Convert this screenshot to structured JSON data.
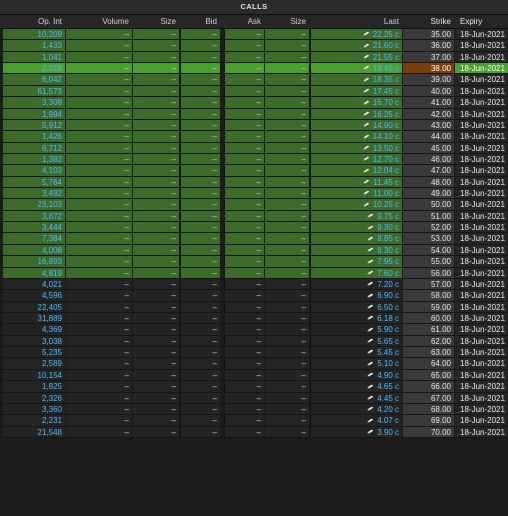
{
  "panel": {
    "title": "CALLS"
  },
  "columns": {
    "op_int": "Op. Int",
    "volume": "Volume",
    "size_bid": "Size",
    "bid": "Bid",
    "ask": "Ask",
    "size_ask": "Size",
    "last": "Last",
    "strike": "Strike",
    "expiry": "Expiry"
  },
  "placeholder": "–",
  "colors": {
    "in_the_money_row": "#3d6b2a",
    "at_the_money_row": "#4aa02c",
    "at_the_money_strike": "#7a3e0c",
    "out_of_money_row": "#242424",
    "value_text": "#4fb8ff"
  },
  "rows": [
    {
      "op_int": "10,209",
      "last": "22.25 c",
      "strike": "35.00",
      "expiry": "18-Jun-2021",
      "state": "itm"
    },
    {
      "op_int": "1,433",
      "last": "21.60 c",
      "strike": "36.00",
      "expiry": "18-Jun-2021",
      "state": "itm"
    },
    {
      "op_int": "1,041",
      "last": "21.55 c",
      "strike": "37.00",
      "expiry": "18-Jun-2021",
      "state": "itm"
    },
    {
      "op_int": "2,028",
      "last": "19.45 c",
      "strike": "38.00",
      "expiry": "18-Jun-2021",
      "state": "atm"
    },
    {
      "op_int": "6,042",
      "last": "18.35 c",
      "strike": "39.00",
      "expiry": "18-Jun-2021",
      "state": "itm"
    },
    {
      "op_int": "61,573",
      "last": "17.45 c",
      "strike": "40.00",
      "expiry": "18-Jun-2021",
      "state": "itm"
    },
    {
      "op_int": "3,308",
      "last": "16.70 c",
      "strike": "41.00",
      "expiry": "18-Jun-2021",
      "state": "itm"
    },
    {
      "op_int": "1,994",
      "last": "16.25 c",
      "strike": "42.00",
      "expiry": "18-Jun-2021",
      "state": "itm"
    },
    {
      "op_int": "5,912",
      "last": "14.90 c",
      "strike": "43.00",
      "expiry": "18-Jun-2021",
      "state": "itm"
    },
    {
      "op_int": "1,426",
      "last": "14.10 c",
      "strike": "44.00",
      "expiry": "18-Jun-2021",
      "state": "itm"
    },
    {
      "op_int": "6,712",
      "last": "13.50 c",
      "strike": "45.00",
      "expiry": "18-Jun-2021",
      "state": "itm"
    },
    {
      "op_int": "1,382",
      "last": "12.70 c",
      "strike": "46.00",
      "expiry": "18-Jun-2021",
      "state": "itm"
    },
    {
      "op_int": "4,103",
      "last": "12.04 c",
      "strike": "47.00",
      "expiry": "18-Jun-2021",
      "state": "itm"
    },
    {
      "op_int": "5,764",
      "last": "11.45 c",
      "strike": "48.00",
      "expiry": "18-Jun-2021",
      "state": "itm"
    },
    {
      "op_int": "3,492",
      "last": "11.00 c",
      "strike": "49.00",
      "expiry": "18-Jun-2021",
      "state": "itm"
    },
    {
      "op_int": "23,103",
      "last": "10.25 c",
      "strike": "50.00",
      "expiry": "18-Jun-2021",
      "state": "itm"
    },
    {
      "op_int": "3,872",
      "last": "9.75 c",
      "strike": "51.00",
      "expiry": "18-Jun-2021",
      "state": "itm"
    },
    {
      "op_int": "3,444",
      "last": "9.30 c",
      "strike": "52.00",
      "expiry": "18-Jun-2021",
      "state": "itm"
    },
    {
      "op_int": "7,384",
      "last": "8.85 c",
      "strike": "53.00",
      "expiry": "18-Jun-2021",
      "state": "itm"
    },
    {
      "op_int": "4,008",
      "last": "8.30 c",
      "strike": "54.00",
      "expiry": "18-Jun-2021",
      "state": "itm"
    },
    {
      "op_int": "16,893",
      "last": "7.95 c",
      "strike": "55.00",
      "expiry": "18-Jun-2021",
      "state": "itm"
    },
    {
      "op_int": "4,819",
      "last": "7.60 c",
      "strike": "56.00",
      "expiry": "18-Jun-2021",
      "state": "itm"
    },
    {
      "op_int": "4,021",
      "last": "7.20 c",
      "strike": "57.00",
      "expiry": "18-Jun-2021",
      "state": "otm"
    },
    {
      "op_int": "4,596",
      "last": "6.90 c",
      "strike": "58.00",
      "expiry": "18-Jun-2021",
      "state": "otm"
    },
    {
      "op_int": "22,405",
      "last": "6.50 c",
      "strike": "59.00",
      "expiry": "18-Jun-2021",
      "state": "otm"
    },
    {
      "op_int": "31,889",
      "last": "6.18 c",
      "strike": "60.00",
      "expiry": "18-Jun-2021",
      "state": "otm"
    },
    {
      "op_int": "4,369",
      "last": "5.90 c",
      "strike": "61.00",
      "expiry": "18-Jun-2021",
      "state": "otm"
    },
    {
      "op_int": "3,038",
      "last": "5.65 c",
      "strike": "62.00",
      "expiry": "18-Jun-2021",
      "state": "otm"
    },
    {
      "op_int": "5,235",
      "last": "5.45 c",
      "strike": "63.00",
      "expiry": "18-Jun-2021",
      "state": "otm"
    },
    {
      "op_int": "2,589",
      "last": "5.10 c",
      "strike": "64.00",
      "expiry": "18-Jun-2021",
      "state": "otm"
    },
    {
      "op_int": "10,154",
      "last": "4.90 c",
      "strike": "65.00",
      "expiry": "18-Jun-2021",
      "state": "otm"
    },
    {
      "op_int": "1,825",
      "last": "4.65 c",
      "strike": "66.00",
      "expiry": "18-Jun-2021",
      "state": "otm"
    },
    {
      "op_int": "2,326",
      "last": "4.45 c",
      "strike": "67.00",
      "expiry": "18-Jun-2021",
      "state": "otm"
    },
    {
      "op_int": "3,360",
      "last": "4.20 c",
      "strike": "68.00",
      "expiry": "18-Jun-2021",
      "state": "otm"
    },
    {
      "op_int": "2,231",
      "last": "4.07 c",
      "strike": "69.00",
      "expiry": "18-Jun-2021",
      "state": "otm"
    },
    {
      "op_int": "21,548",
      "last": "3.90 c",
      "strike": "70.00",
      "expiry": "18-Jun-2021",
      "state": "otm"
    }
  ]
}
